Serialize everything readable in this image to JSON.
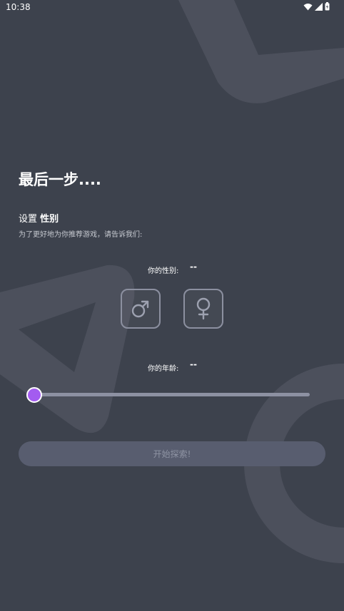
{
  "status_bar": {
    "time": "10:38",
    "icons": [
      "wifi-icon",
      "cellular-signal-icon",
      "battery-icon"
    ]
  },
  "page": {
    "title": "最后一步....",
    "section_prefix": "设置 ",
    "section_strong": "性别",
    "subtitle": "为了更好地为你推荐游戏，请告诉我们:"
  },
  "gender": {
    "label": "你的性别:",
    "value": "--",
    "options": [
      {
        "icon": "male-symbol-icon",
        "glyph": "♂"
      },
      {
        "icon": "female-symbol-icon",
        "glyph": "♀"
      }
    ]
  },
  "age": {
    "label": "你的年龄:",
    "value": "--",
    "slider_level": 0
  },
  "start_button": {
    "label": "开始探索!"
  },
  "colors": {
    "background": "#3d424d",
    "accent": "#a35cf0",
    "button_disabled": "#585d6f"
  }
}
